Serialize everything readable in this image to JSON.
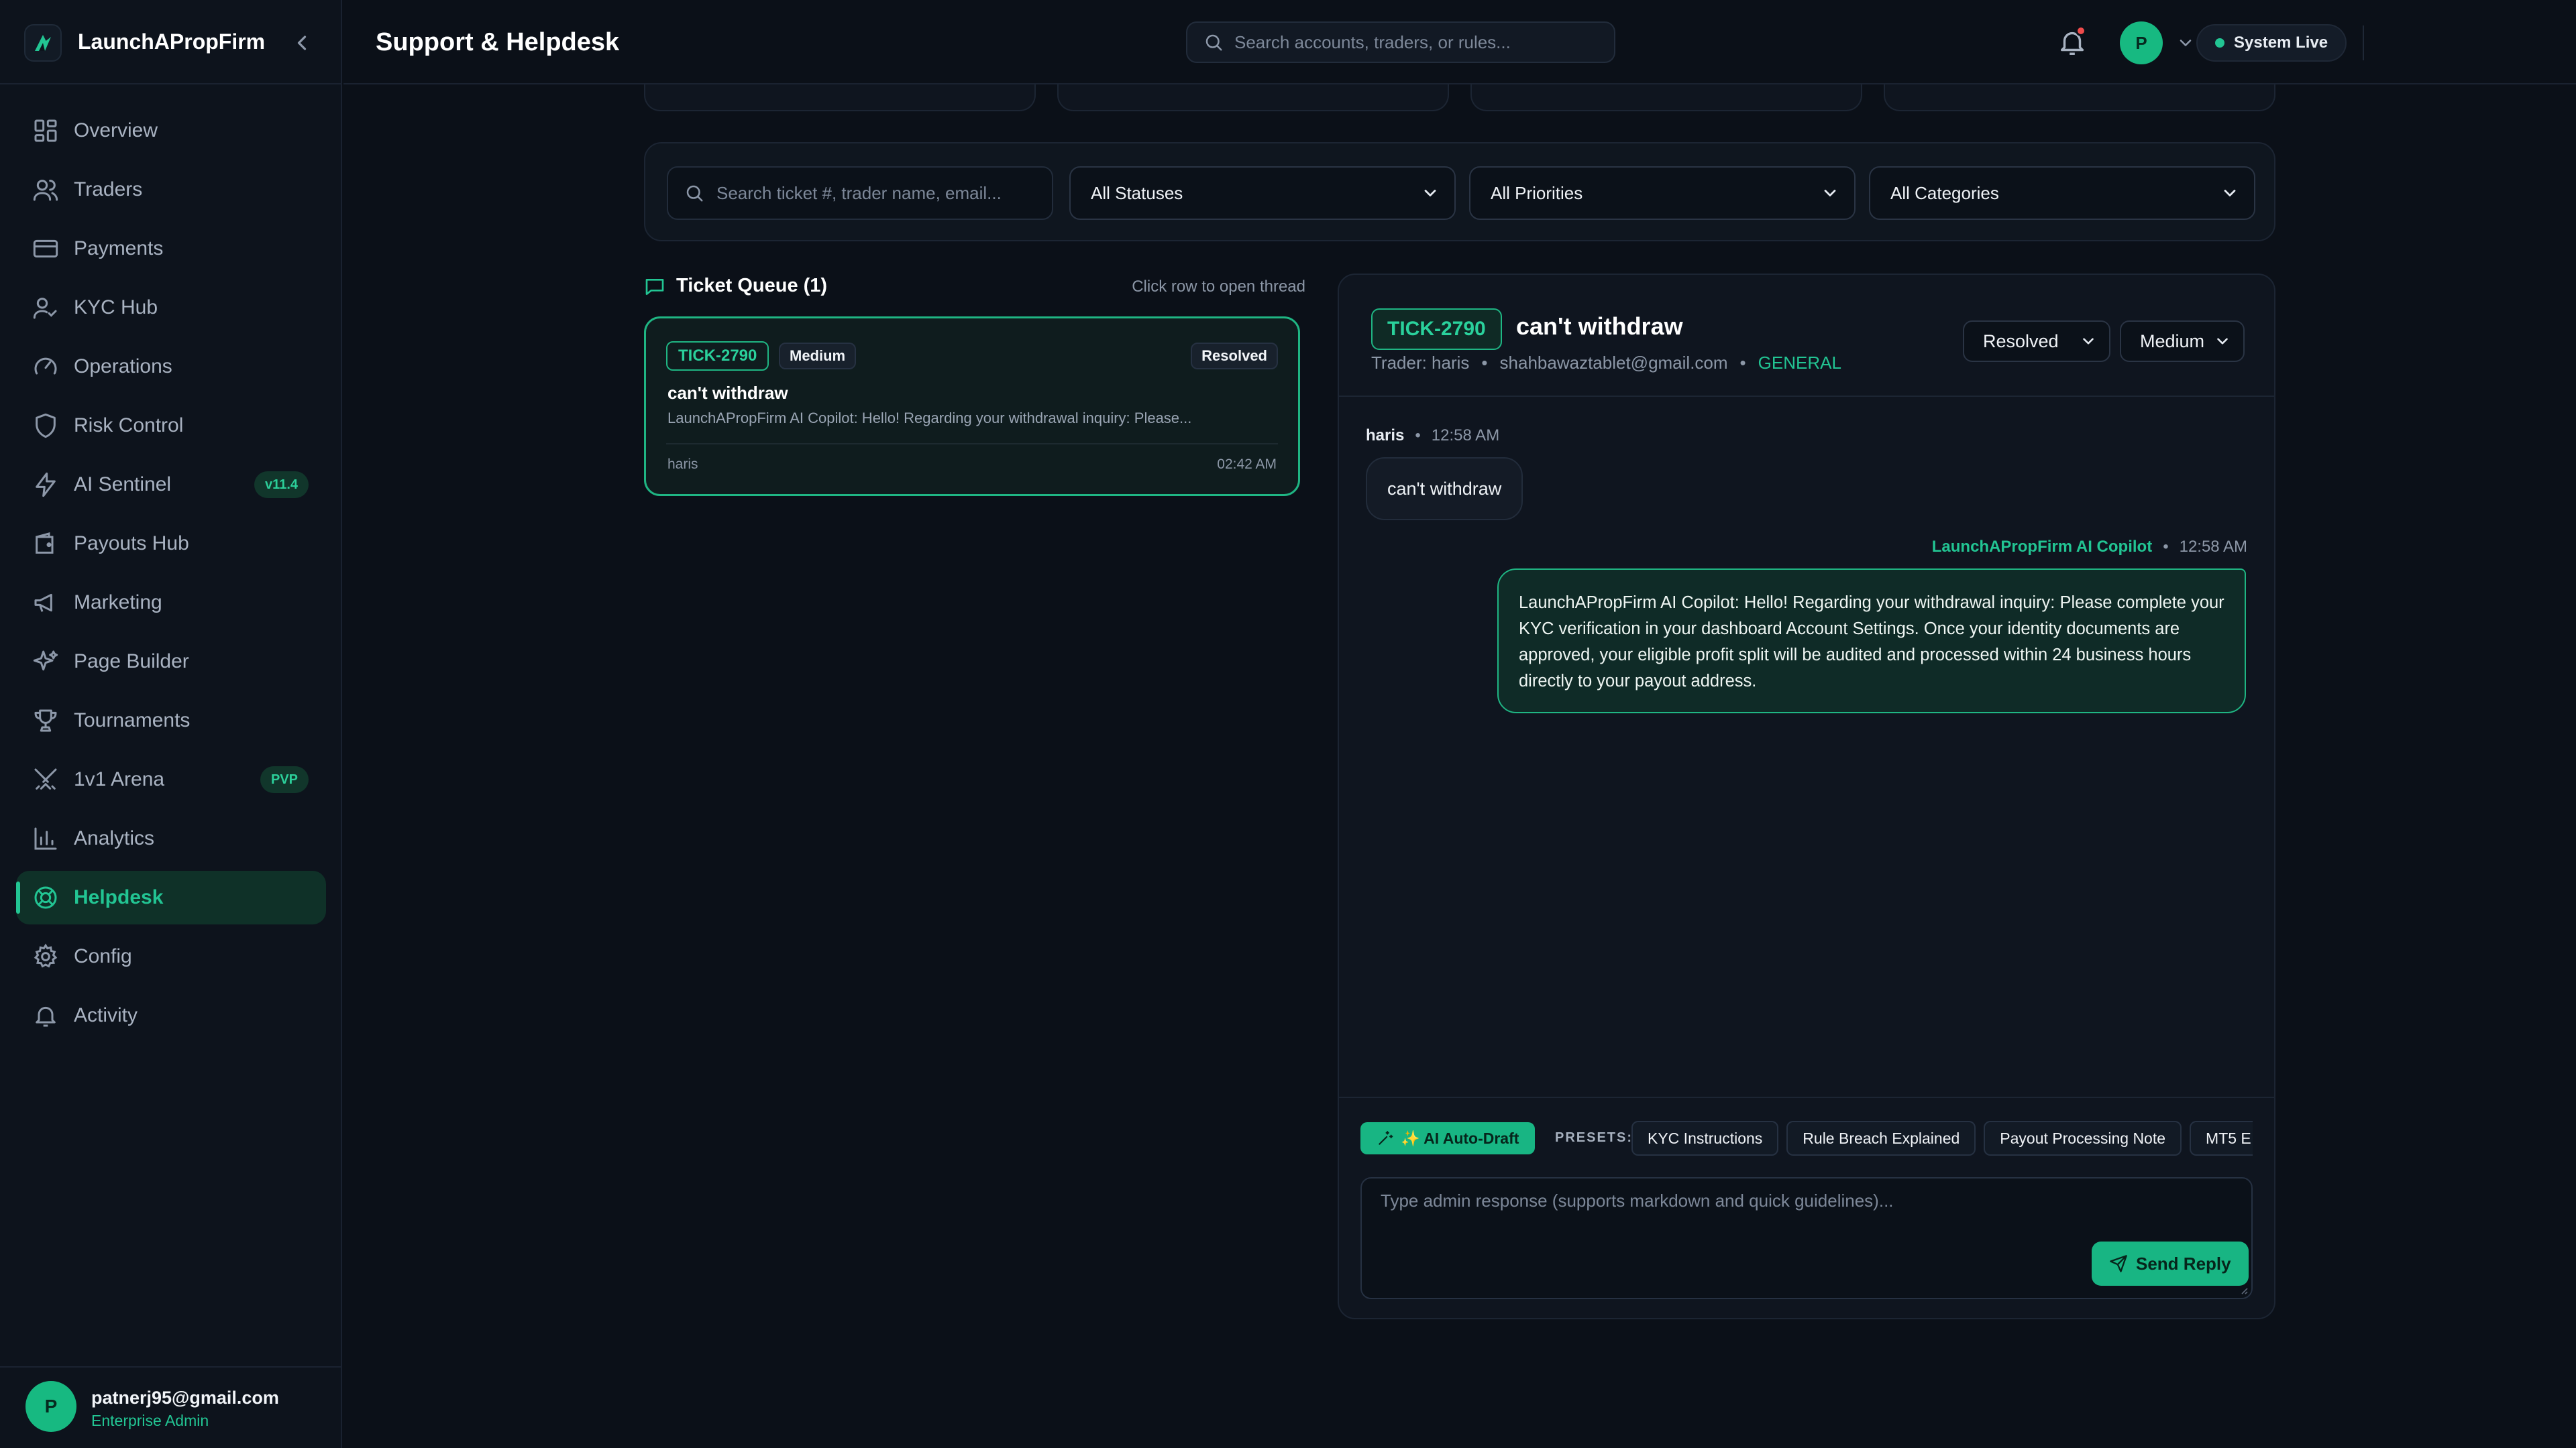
{
  "app": {
    "name": "LaunchAPropFirm"
  },
  "header": {
    "title": "Support & Helpdesk",
    "search_placeholder": "Search accounts, traders, or rules...",
    "status": "System Live",
    "avatar_initial": "P"
  },
  "sidebar": {
    "items": [
      {
        "label": "Overview",
        "icon": "grid-icon"
      },
      {
        "label": "Traders",
        "icon": "users-icon"
      },
      {
        "label": "Payments",
        "icon": "credit-card-icon"
      },
      {
        "label": "KYC Hub",
        "icon": "user-check-icon"
      },
      {
        "label": "Operations",
        "icon": "gauge-icon"
      },
      {
        "label": "Risk Control",
        "icon": "shield-icon"
      },
      {
        "label": "AI Sentinel",
        "icon": "bolt-icon",
        "badge": "v11.4"
      },
      {
        "label": "Payouts Hub",
        "icon": "wallet-icon"
      },
      {
        "label": "Marketing",
        "icon": "megaphone-icon"
      },
      {
        "label": "Page Builder",
        "icon": "sparkles-icon"
      },
      {
        "label": "Tournaments",
        "icon": "trophy-icon"
      },
      {
        "label": "1v1 Arena",
        "icon": "swords-icon",
        "badge": "PVP"
      },
      {
        "label": "Analytics",
        "icon": "bar-chart-icon"
      },
      {
        "label": "Helpdesk",
        "icon": "lifebuoy-icon",
        "active": true
      },
      {
        "label": "Config",
        "icon": "gear-icon"
      },
      {
        "label": "Activity",
        "icon": "bell-icon"
      }
    ],
    "user": {
      "email": "patnerj95@gmail.com",
      "role": "Enterprise Admin",
      "initial": "P"
    }
  },
  "filters": {
    "search_placeholder": "Search ticket #, trader name, email...",
    "status": "All Statuses",
    "priority": "All Priorities",
    "category": "All Categories"
  },
  "queue": {
    "title": "Ticket Queue (1)",
    "hint": "Click row to open thread",
    "tickets": [
      {
        "id": "TICK-2790",
        "priority": "Medium",
        "status": "Resolved",
        "subject": "can't withdraw",
        "preview": "LaunchAPropFirm AI Copilot: Hello! Regarding your withdrawal inquiry: Please...",
        "trader": "haris",
        "time": "02:42 AM"
      }
    ]
  },
  "thread": {
    "id": "TICK-2790",
    "subject": "can't withdraw",
    "trader_label": "Trader: haris",
    "email": "shahbawaztablet@gmail.com",
    "category": "GENERAL",
    "status_value": "Resolved",
    "priority_value": "Medium",
    "messages": [
      {
        "author": "haris",
        "time": "12:58 AM",
        "text": "can't withdraw"
      },
      {
        "author": "LaunchAPropFirm AI Copilot",
        "time": "12:58 AM",
        "text": "LaunchAPropFirm AI Copilot: Hello! Regarding your withdrawal inquiry: Please complete your KYC verification in your dashboard Account Settings. Once your identity documents are approved, your eligible profit split will be audited and processed within 24 business hours directly to your payout address."
      }
    ]
  },
  "composer": {
    "ai_draft_label": "✨ AI Auto-Draft",
    "presets_label": "PRESETS:",
    "presets": [
      "KYC Instructions",
      "Rule Breach Explained",
      "Payout Processing Note",
      "MT5 E"
    ],
    "placeholder": "Type admin response (supports markdown and quick guidelines)...",
    "send_label": "Send Reply"
  },
  "colors": {
    "accent": "#22c593",
    "background": "#0b1018",
    "panel": "#0f151f",
    "alert": "#ef4b4b"
  }
}
